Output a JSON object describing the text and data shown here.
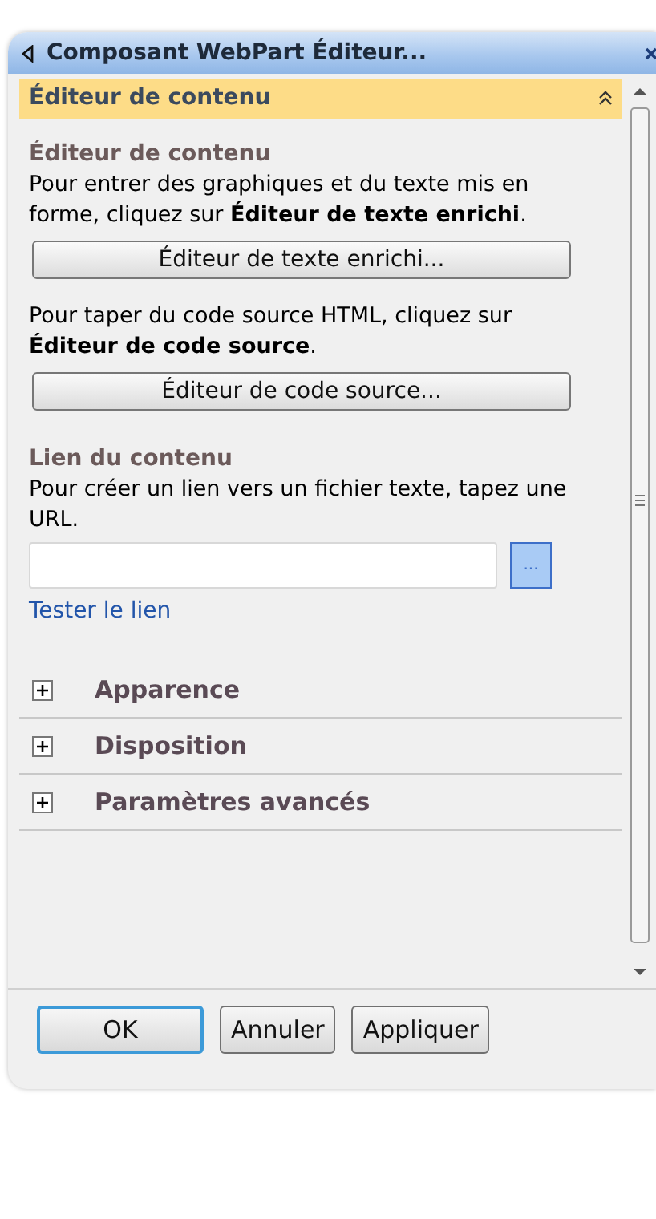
{
  "window": {
    "title": "Composant WebPart Éditeur..."
  },
  "panel": {
    "title": "Éditeur de contenu",
    "expanded": true
  },
  "content": [
    {
      "kind": "heading",
      "text": "Éditeur de contenu"
    },
    {
      "kind": "paragraph",
      "text": "Pour entrer des graphiques et du texte mis en forme, cliquez sur **Éditeur de texte enrichi**."
    },
    {
      "kind": "button",
      "text": "Éditeur de texte enrichi..."
    },
    {
      "kind": "paragraph",
      "text": "Pour taper du code source HTML, cliquez sur **Éditeur de code source**."
    },
    {
      "kind": "button",
      "text": "Éditeur de code source..."
    },
    {
      "kind": "heading",
      "text": "Lien du contenu"
    },
    {
      "kind": "paragraph",
      "text": "Pour créer un lien vers un fichier texte, tapez une URL."
    },
    {
      "kind": "field",
      "browse": "..."
    },
    {
      "kind": "link",
      "text": "Tester le lien"
    }
  ],
  "sections": [
    {
      "title": "Apparence",
      "expanded": false
    },
    {
      "title": "Disposition",
      "expanded": false
    },
    {
      "title": "Paramètres avancés",
      "expanded": false
    }
  ],
  "buttons": [
    {
      "label": "OK",
      "focused": true
    },
    {
      "label": "Annuler",
      "focused": false
    },
    {
      "label": "Appliquer",
      "focused": false
    }
  ]
}
